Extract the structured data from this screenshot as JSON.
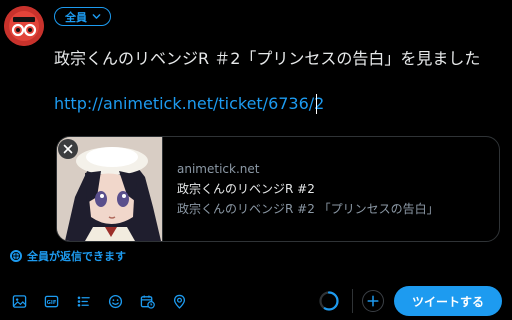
{
  "composer": {
    "audience_label": "全員",
    "text": "政宗くんのリベンジR ＃2「プリンセスの告白」を見ました",
    "link": "http://animetick.net/ticket/6736/2"
  },
  "card": {
    "domain": "animetick.net",
    "title": "政宗くんのリベンジR #2",
    "description": "政宗くんのリベンジR #2 「プリンセスの告白」"
  },
  "reply_setting": {
    "label": "全員が返信できます"
  },
  "toolbar": {
    "icons": [
      "image-icon",
      "gif-icon",
      "poll-icon",
      "emoji-icon",
      "schedule-icon",
      "location-icon"
    ],
    "tweet_button_label": "ツイートする"
  },
  "colors": {
    "accent": "#1d9bf0",
    "background": "#000000",
    "border": "#2f3336",
    "muted_text": "#8b98a5"
  }
}
